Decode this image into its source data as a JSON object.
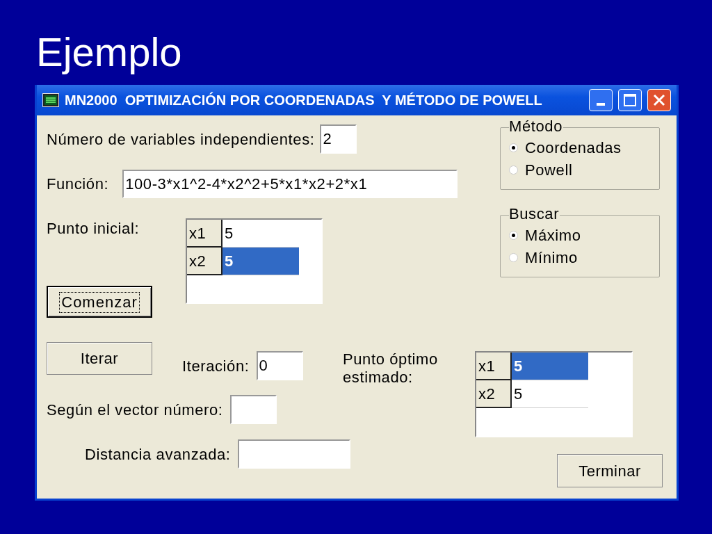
{
  "slide_title": "Ejemplo",
  "window": {
    "title": "MN2000  OPTIMIZACIÓN POR COORDENADAS  Y MÉTODO DE POWELL"
  },
  "variables": {
    "label": "Número de variables independientes:",
    "value": "2"
  },
  "function": {
    "label": "Función:",
    "value": "100-3*x1^2-4*x2^2+5*x1*x2+2*x1"
  },
  "initial_point": {
    "label": "Punto inicial:",
    "rows": [
      {
        "name": "x1",
        "value": "5",
        "selected": false
      },
      {
        "name": "x2",
        "value": "5",
        "selected": true
      }
    ]
  },
  "start_button": {
    "label": "Comenzar",
    "focused": true
  },
  "iterate_button": {
    "label": "Iterar",
    "focused": false
  },
  "iteration": {
    "label": "Iteración:",
    "value": "0"
  },
  "vector": {
    "label": "Según el vector número:"
  },
  "distance": {
    "label": "Distancia avanzada:"
  },
  "optimum": {
    "label": "Punto óptimo estimado:",
    "rows": [
      {
        "name": "x1",
        "value": "5",
        "selected": true
      },
      {
        "name": "x2",
        "value": "5",
        "selected": false
      }
    ]
  },
  "method_group": {
    "title": "Método",
    "options": [
      {
        "label": "Coordenadas",
        "selected": true
      },
      {
        "label": "Powell",
        "selected": false
      }
    ]
  },
  "search_group": {
    "title": "Buscar",
    "options": [
      {
        "label": "Máximo",
        "selected": true
      },
      {
        "label": "Mínimo",
        "selected": false
      }
    ]
  },
  "finish_button": {
    "label": "Terminar",
    "focused": false
  }
}
